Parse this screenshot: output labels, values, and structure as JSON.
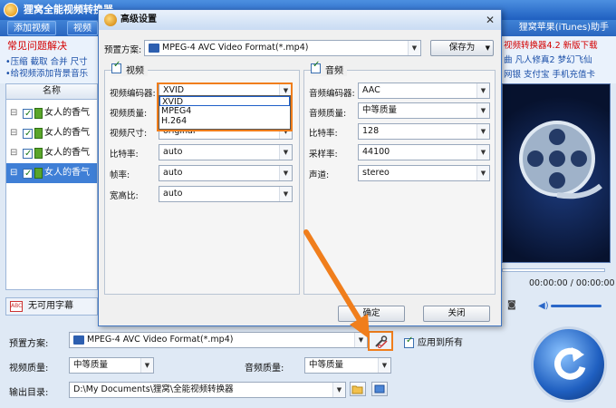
{
  "main": {
    "title": "狸窝全能视频转换器",
    "right_title": "狸窝苹果(iTunes)助手",
    "toolbar": {
      "add_video": "添加视频",
      "video_edit": "视频"
    },
    "faq": {
      "title": "常见问题解决",
      "links": [
        "•压缩 截取 合并 尺寸",
        "•给视频添加背景音乐"
      ]
    },
    "list": {
      "header": "名称",
      "rows": [
        "女人的香气",
        "女人的香气",
        "女人的香气",
        "女人的香气"
      ]
    },
    "subtitle": "无可用字幕",
    "right_links": {
      "line1": "视频转换器4.2 新版下载",
      "line2": "曲 凡人修真2 梦幻飞仙",
      "line3": "网银 支付宝 手机充值卡"
    },
    "time": "00:00:00 / 00:00:00",
    "bottom": {
      "preset_label": "预置方案:",
      "preset_value": "MPEG-4 AVC Video Format(*.mp4)",
      "apply_all": "应用到所有",
      "video_quality_label": "视频质量:",
      "video_quality_value": "中等质量",
      "audio_quality_label": "音频质量:",
      "audio_quality_value": "中等质量",
      "output_label": "输出目录:",
      "output_value": "D:\\My Documents\\狸窝\\全能视频转换器"
    }
  },
  "dialog": {
    "title": "高级设置",
    "preset_label": "预置方案:",
    "preset_value": "MPEG-4 AVC Video Format(*.mp4)",
    "save_as": "保存为",
    "video": {
      "group": "视频",
      "encoder_label": "视频编码器:",
      "encoder_value": "XVID",
      "quality_label": "视频质量:",
      "size_label": "视频尺寸:",
      "size_value": "original",
      "bitrate_label": "比特率:",
      "bitrate_value": "auto",
      "fps_label": "帧率:",
      "fps_value": "auto",
      "aspect_label": "宽高比:",
      "aspect_value": "auto",
      "encoder_options": [
        "XVID",
        "MPEG4",
        "H.264"
      ]
    },
    "audio": {
      "group": "音频",
      "encoder_label": "音频编码器:",
      "encoder_value": "AAC",
      "quality_label": "音频质量:",
      "quality_value": "中等质量",
      "bitrate_label": "比特率:",
      "bitrate_value": "128",
      "sample_label": "采样率:",
      "sample_value": "44100",
      "channel_label": "声道:",
      "channel_value": "stereo"
    },
    "ok": "确定",
    "close": "关闭"
  },
  "colors": {
    "title_blue": "#1f5fc0",
    "highlight_orange": "#f07e1c",
    "link_red": "#d40000",
    "link_blue": "#1a4fa8"
  }
}
